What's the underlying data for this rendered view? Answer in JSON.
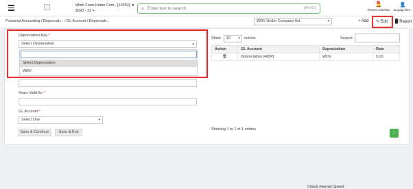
{
  "header": {
    "company_name": "Work From Home Com...[10252]",
    "year": "2020 - 21",
    "search_placeholder": "Enter text to search",
    "search_shortcut": "[Alt+G]",
    "recent_label": "Recent Activities",
    "recent_badge": "0",
    "user_label": "anujagl.shm..",
    "icons": {
      "menu": "hamburger-icon",
      "search": "search-icon",
      "bell": "bell-icon",
      "user": "user-icon",
      "edit": "pencil-icon"
    }
  },
  "breadcrumb": "Financial Accounting  / Depreciati... / GL Account / Depreciati...",
  "method_select": "WDV Under Company Act",
  "toolbar": {
    "add": "Add",
    "edit": "Edit",
    "report": "Report"
  },
  "form": {
    "depreciation_key_label": "Depreciation Key",
    "depreciation_key_value": "Select Depreciation",
    "dropdown_options": [
      "Select Depreciation",
      "WDV"
    ],
    "years_valid_label": "Years Valid for",
    "gl_account_label": "GL Account",
    "gl_account_value": "Select One",
    "save_continue": "Save & Continue",
    "save_exit": "Save & Exit"
  },
  "table": {
    "show_label": "Show",
    "entries_value": "10",
    "entries_label": "entries",
    "search_label": "Search:",
    "columns": [
      "Action",
      "GL Account",
      "Depreciation",
      "Rate"
    ],
    "rows": [
      {
        "action_icon": "trash-icon",
        "gl_account": "Depreciation [400P]",
        "depreciation": "WDV",
        "rate": "5.00"
      }
    ],
    "info": "Showing 1 to 1 of 1 entries"
  },
  "footer_note": "Check Internet Speed",
  "colors": {
    "highlight": "#e02020",
    "search_border": "#67b36a",
    "up_button": "#4caf50"
  }
}
